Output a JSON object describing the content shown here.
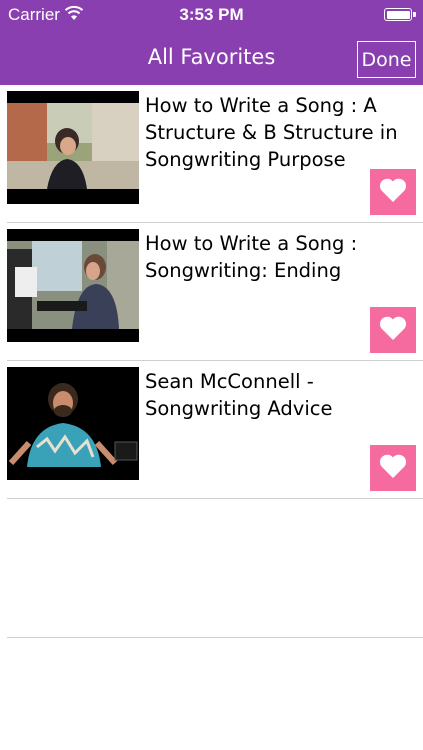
{
  "status_bar": {
    "carrier": "Carrier",
    "time": "3:53 PM",
    "battery_level": 1.0
  },
  "nav": {
    "title": "All Favorites",
    "done_label": "Done"
  },
  "colors": {
    "nav_background": "#8a3fb0",
    "heart_button": "#f56ba0"
  },
  "favorites": [
    {
      "title": "How to Write a Song : A Structure & B Structure in Songwriting Purpose",
      "icon": "heart-icon"
    },
    {
      "title": "How to Write a Song : Songwriting: Ending",
      "icon": "heart-icon"
    },
    {
      "title": "Sean McConnell - Songwriting Advice",
      "icon": "heart-icon"
    }
  ]
}
